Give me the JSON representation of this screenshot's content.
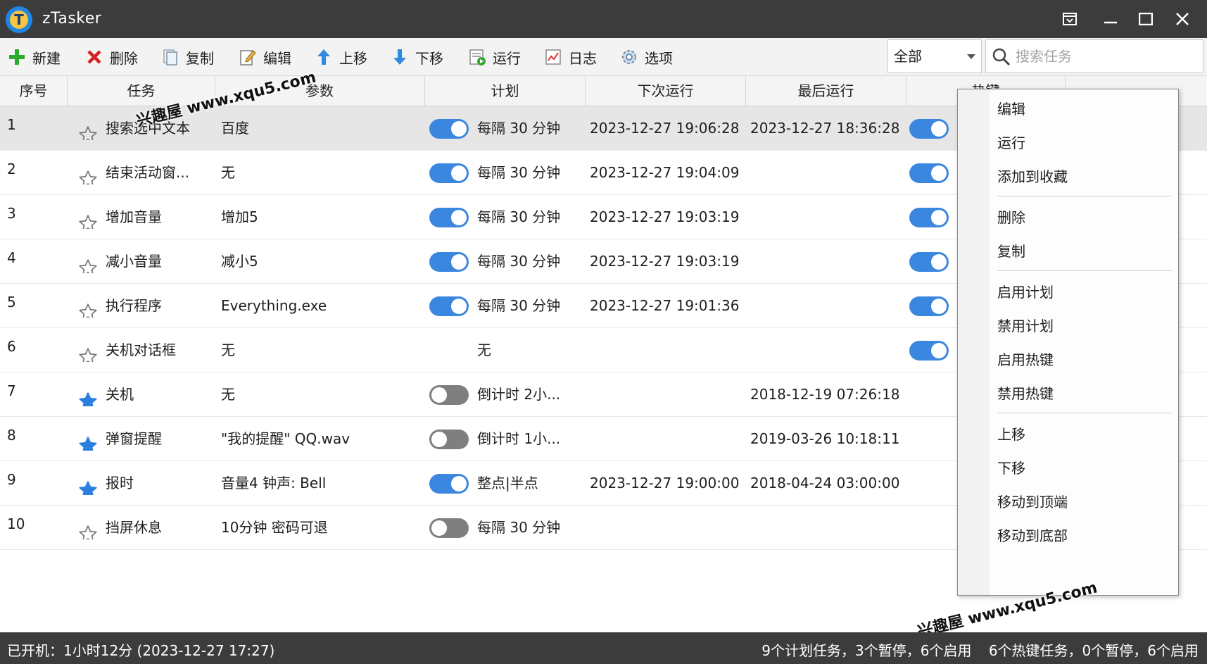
{
  "app": {
    "title": "zTasker",
    "logo_letter": "T"
  },
  "toolbar": {
    "new": "新建",
    "delete": "删除",
    "copy": "复制",
    "edit": "编辑",
    "move_up": "上移",
    "move_down": "下移",
    "run": "运行",
    "log": "日志",
    "options": "选项"
  },
  "filter": {
    "selected": "全部"
  },
  "search": {
    "placeholder": "搜索任务"
  },
  "columns": [
    "序号",
    "任务",
    "参数",
    "计划",
    "下次运行",
    "最后运行",
    "热键"
  ],
  "tasks": [
    {
      "num": "1",
      "starred": false,
      "name": "搜索选中文本",
      "param": "百度",
      "plan_on": true,
      "plan": "每隔 30 分钟",
      "next": "2023-12-27 19:06:28",
      "last": "2023-12-27 18:36:28",
      "hotkey_on": true,
      "selected": true
    },
    {
      "num": "2",
      "starred": false,
      "name": "结束活动窗...",
      "param": "无",
      "plan_on": true,
      "plan": "每隔 30 分钟",
      "next": "2023-12-27 19:04:09",
      "last": "",
      "hotkey_on": true
    },
    {
      "num": "3",
      "starred": false,
      "name": "增加音量",
      "param": "增加5",
      "plan_on": true,
      "plan": "每隔 30 分钟",
      "next": "2023-12-27 19:03:19",
      "last": "",
      "hotkey_on": true
    },
    {
      "num": "4",
      "starred": false,
      "name": "减小音量",
      "param": "减小5",
      "plan_on": true,
      "plan": "每隔 30 分钟",
      "next": "2023-12-27 19:03:19",
      "last": "",
      "hotkey_on": true
    },
    {
      "num": "5",
      "starred": false,
      "name": "执行程序",
      "param": "Everything.exe",
      "plan_on": true,
      "plan": "每隔 30 分钟",
      "next": "2023-12-27 19:01:36",
      "last": "",
      "hotkey_on": true
    },
    {
      "num": "6",
      "starred": false,
      "name": "关机对话框",
      "param": "无",
      "plan_on": null,
      "plan": "无",
      "next": "",
      "last": "",
      "hotkey_on": true
    },
    {
      "num": "7",
      "starred": true,
      "name": "关机",
      "param": "无",
      "plan_on": false,
      "plan": "倒计时 2小...",
      "next": "",
      "last": "2018-12-19 07:26:18",
      "hotkey_on": null
    },
    {
      "num": "8",
      "starred": true,
      "name": "弹窗提醒",
      "param": "\"我的提醒\" QQ.wav",
      "plan_on": false,
      "plan": "倒计时 1小...",
      "next": "",
      "last": "2019-03-26 10:18:11",
      "hotkey_on": null
    },
    {
      "num": "9",
      "starred": true,
      "name": "报时",
      "param": "音量4 钟声: Bell",
      "plan_on": true,
      "plan": "整点|半点",
      "next": "2023-12-27 19:00:00",
      "last": "2018-04-24 03:00:00",
      "hotkey_on": null
    },
    {
      "num": "10",
      "starred": false,
      "name": "挡屏休息",
      "param": "10分钟 密码可退",
      "plan_on": false,
      "plan": "每隔 30 分钟",
      "next": "",
      "last": "",
      "hotkey_on": null
    }
  ],
  "context_menu": {
    "items": [
      "编辑",
      "运行",
      "添加到收藏",
      "删除",
      "复制",
      "启用计划",
      "禁用计划",
      "启用热键",
      "禁用热键",
      "上移",
      "下移",
      "移动到顶端",
      "移动到底部"
    ]
  },
  "watermark": "兴趣屋 www.xqu5.com",
  "status": {
    "uptime": "已开机：1小时12分 (2023-12-27 17:27)",
    "scheduled": "9个计划任务，3个暂停，6个启用",
    "hotkeys": "6个热键任务，0个暂停，6个启用"
  },
  "colors": {
    "accent": "#3b87e0",
    "titlebar": "#3c3c3c",
    "star_filled": "#2a7fe0"
  }
}
